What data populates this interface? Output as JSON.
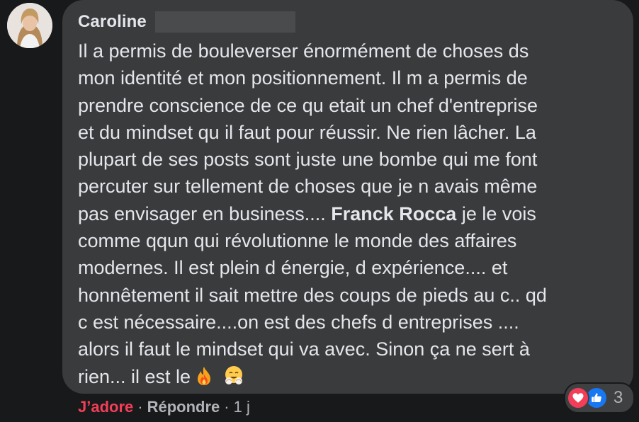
{
  "comment": {
    "author": "Caroline",
    "lines": [
      "Il a permis de bouleverser énormément de choses ds",
      "mon identité et mon positionnement. Il m a permis de",
      "prendre conscience de ce qu etait un chef d'entreprise",
      "et du mindset qu il faut pour réussir. Ne rien lâcher. La",
      "plupart de ses posts sont juste une bombe qui me font",
      "percuter sur tellement de choses que je n avais même",
      "pas envisager en business....",
      "comme qqun qui révolutionne le monde des affaires",
      "modernes. Il est plein d énergie, d expérience.... et",
      "honnêtement il sait mettre des coups de pieds au c.. qd",
      "c est nécessaire....on est des chefs d entreprises ....",
      "alors il faut le mindset qui va avec. Sinon ça ne sert à",
      "rien... il est le"
    ],
    "mention": "Franck Rocca",
    "mention_after": " je le vois",
    "emojis": [
      "fire-emoji",
      "hugging-face-emoji"
    ]
  },
  "reactions": {
    "count": "3",
    "icons": [
      "heart-icon",
      "thumbs-up-icon"
    ],
    "colors": {
      "love": "#f33e58",
      "like": "#1877f2"
    }
  },
  "actions": {
    "love_label": "J’adore",
    "separator": "·",
    "reply_label": "Répondre",
    "time": "1 j"
  }
}
